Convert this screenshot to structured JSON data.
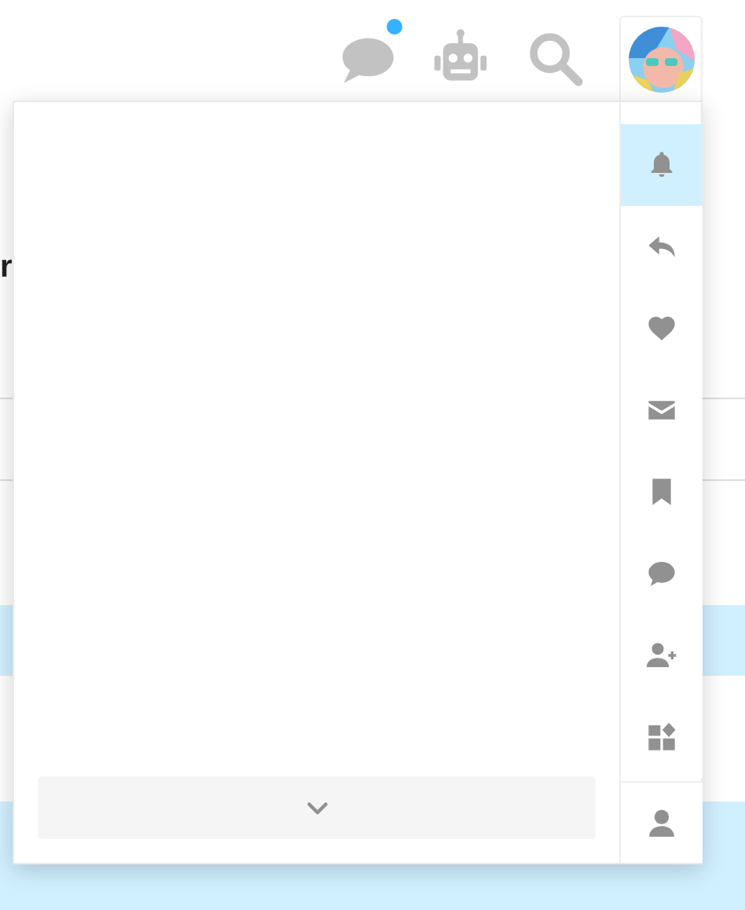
{
  "header": {
    "icons": [
      {
        "kind": "chat",
        "unread": true
      },
      {
        "kind": "robot"
      },
      {
        "kind": "search"
      }
    ]
  },
  "background_page": {
    "heading": "r"
  },
  "user_menu": {
    "tabs": [
      {
        "kind": "bell",
        "selected": true
      },
      {
        "kind": "reply",
        "selected": false
      },
      {
        "kind": "heart",
        "selected": false
      },
      {
        "kind": "envelope",
        "selected": false
      },
      {
        "kind": "bookmark",
        "selected": false
      },
      {
        "kind": "chat",
        "selected": false
      },
      {
        "kind": "user-plus",
        "selected": false
      },
      {
        "kind": "widgets",
        "selected": false
      }
    ],
    "bottom_tabs": [
      {
        "kind": "user",
        "selected": false
      }
    ],
    "show_more": {
      "kind": "chevron-down"
    }
  }
}
